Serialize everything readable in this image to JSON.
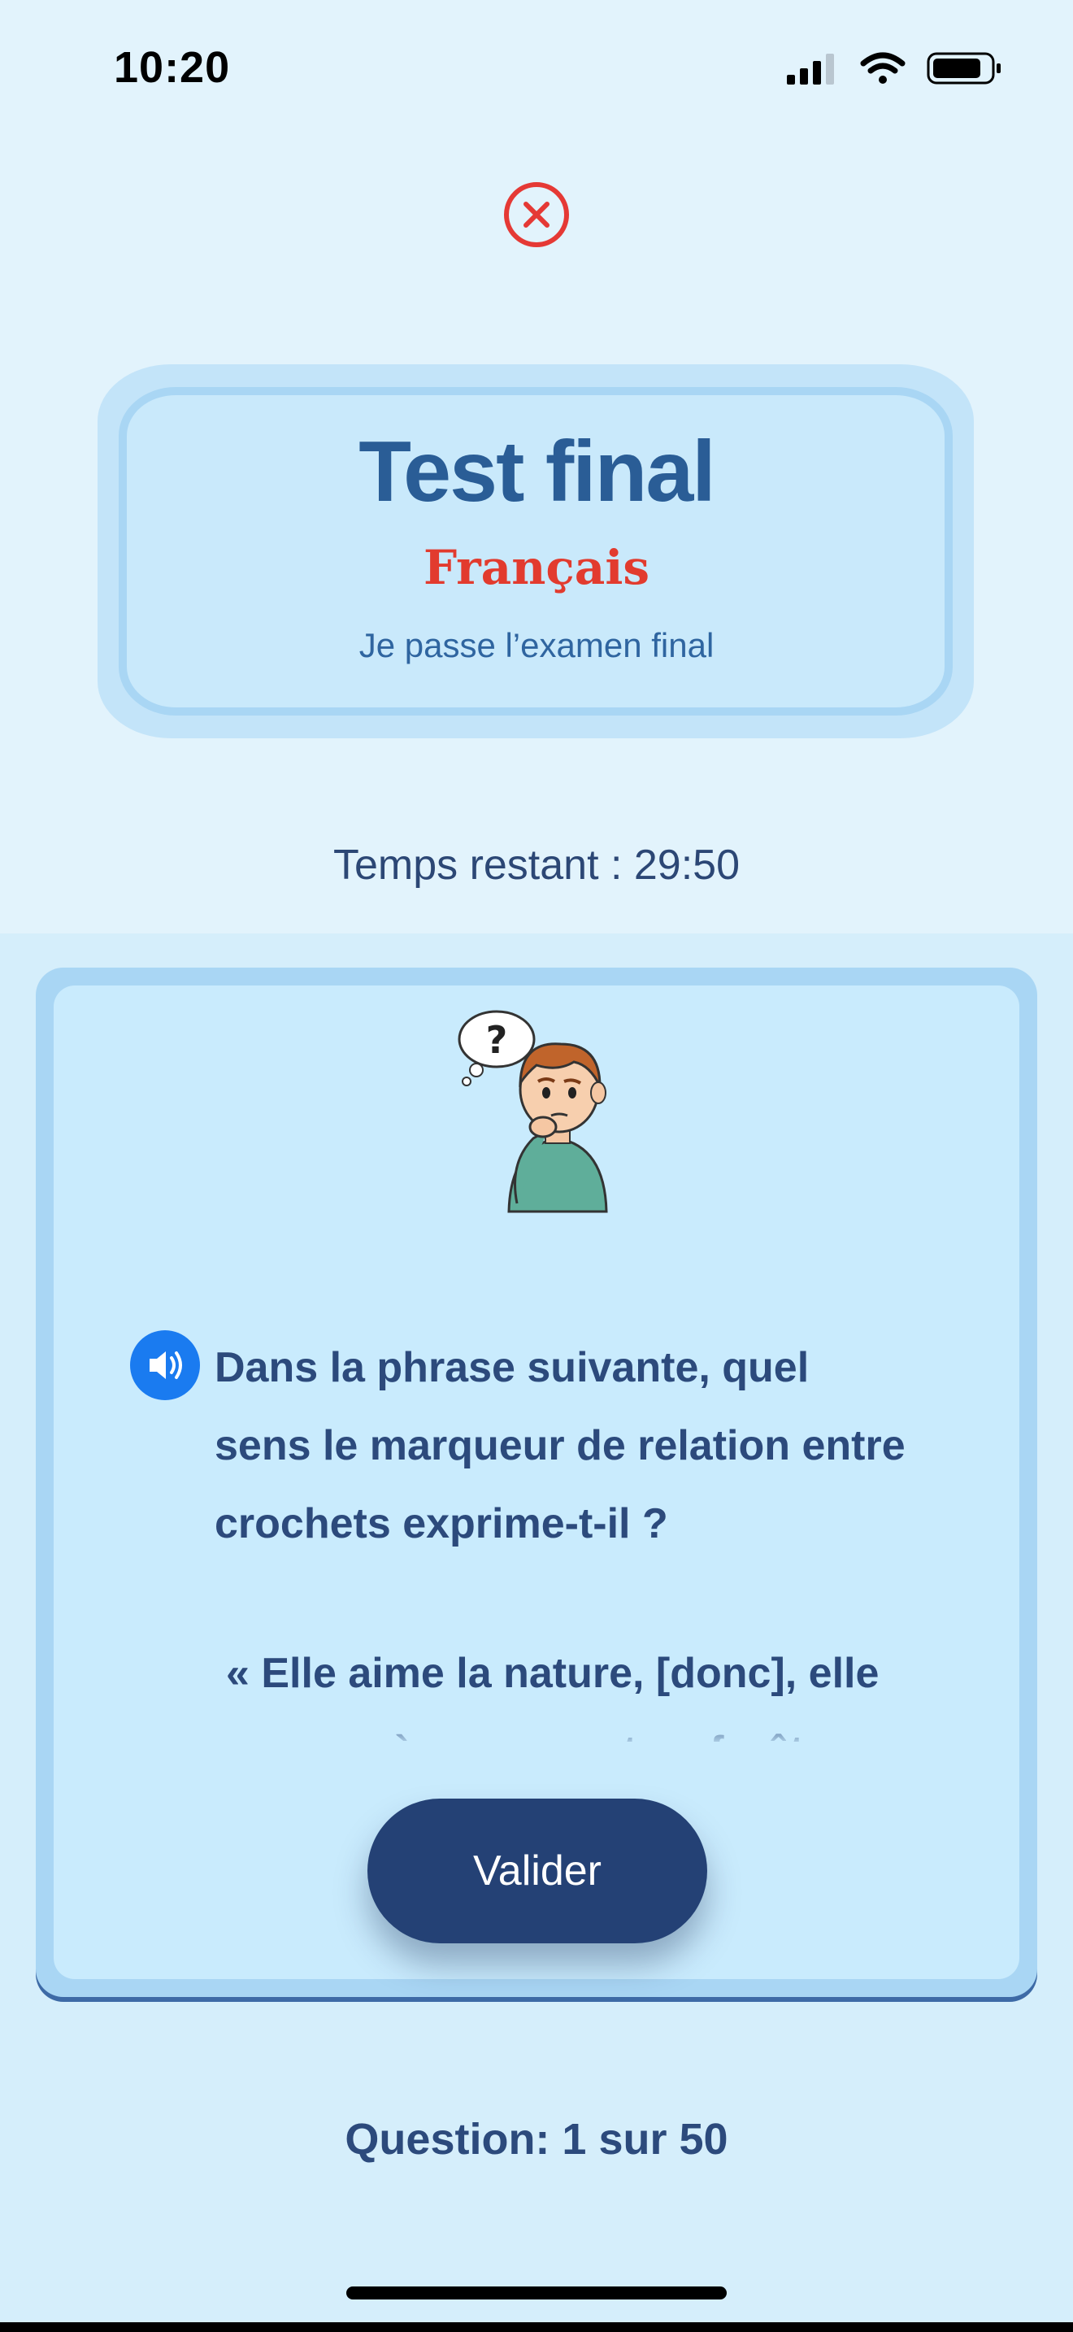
{
  "status_bar": {
    "time": "10:20",
    "icons": [
      "cellular-signal-icon",
      "wifi-icon",
      "battery-icon"
    ]
  },
  "header": {
    "close_icon": "close-circle-icon",
    "title": "Test final",
    "subject": "Français",
    "subtitle": "Je passe l’examen final",
    "timer": "Temps restant : 29:50"
  },
  "question": {
    "illustration": "thinking-boy",
    "speaker_icon": "speaker-icon",
    "text": "Dans la phrase suivante, quel sens le marqueur de relation entre crochets exprime-t-il ?",
    "quote": "« Elle aime la nature, [donc], elle se promène souvent en forêt. »",
    "validate_label": "Valider"
  },
  "footer": {
    "counter": "Question: 1  sur 50"
  },
  "colors": {
    "accent": "#244175",
    "title": "#2a5d96",
    "subject": "#e23b2e",
    "close": "#e53935",
    "speaker": "#1a7bf0"
  }
}
